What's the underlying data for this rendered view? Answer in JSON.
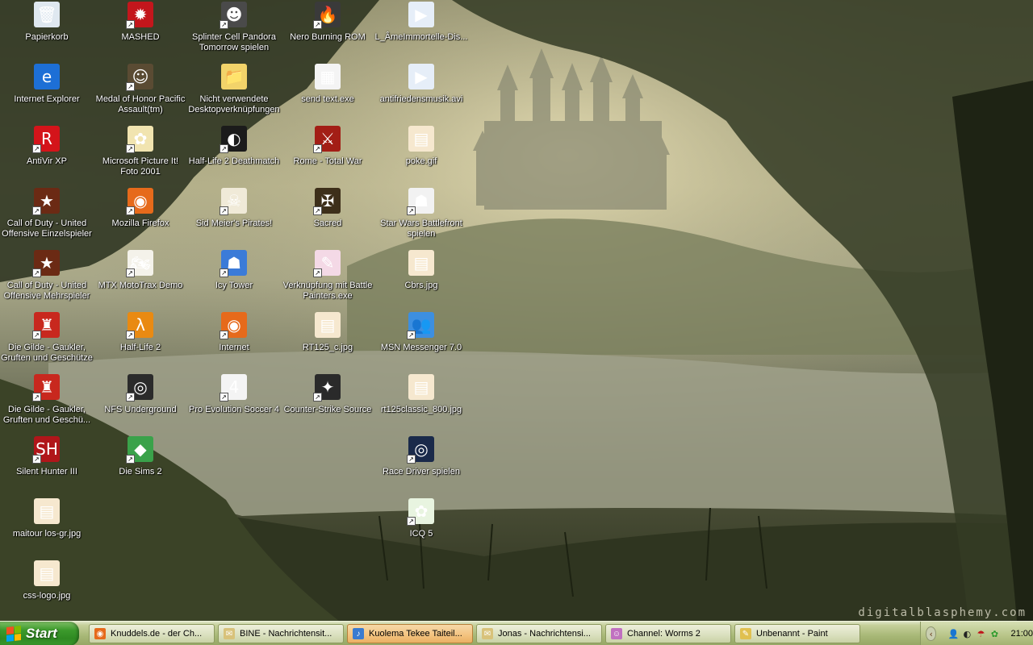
{
  "wallpaper": {
    "watermark": "digitalblasphemy.com"
  },
  "desktop_icons": [
    {
      "label": "Papierkorb",
      "icon": "recycle-bin-icon",
      "glyph": "🗑",
      "bg": "#dfe8f0",
      "shortcut": false
    },
    {
      "label": "Internet Explorer",
      "icon": "internet-explorer-icon",
      "glyph": "e",
      "bg": "#1d6fd6",
      "shortcut": false
    },
    {
      "label": "AntiVir XP",
      "icon": "antivir-icon",
      "glyph": "R",
      "bg": "#d4141a",
      "shortcut": true
    },
    {
      "label": "Call of Duty - United Offensive Einzelspieler",
      "icon": "call-of-duty-icon",
      "glyph": "★",
      "bg": "#6b2a14",
      "shortcut": true
    },
    {
      "label": "Call of Duty - United Offensive Mehrspieler",
      "icon": "call-of-duty-icon",
      "glyph": "★",
      "bg": "#6b2a14",
      "shortcut": true
    },
    {
      "label": "Die Gilde - Gaukler, Gruften und Geschütze",
      "icon": "die-gilde-icon",
      "glyph": "♜",
      "bg": "#c8281e",
      "shortcut": true
    },
    {
      "label": "Die Gilde - Gaukler, Gruften und Geschü...",
      "icon": "die-gilde-icon",
      "glyph": "♜",
      "bg": "#c8281e",
      "shortcut": true
    },
    {
      "label": "Silent Hunter III",
      "icon": "silent-hunter-icon",
      "glyph": "SH",
      "bg": "#b0161a",
      "shortcut": true
    },
    {
      "label": "maitour los-gr.jpg",
      "icon": "image-file-icon",
      "glyph": "▤",
      "bg": "#f6e8cf",
      "shortcut": false
    },
    {
      "label": "css-logo.jpg",
      "icon": "image-file-icon",
      "glyph": "▤",
      "bg": "#f6e8cf",
      "shortcut": false
    },
    {
      "label": "MASHED",
      "icon": "mashed-icon",
      "glyph": "✹",
      "bg": "#c3161c",
      "shortcut": true
    },
    {
      "label": "Medal of Honor Pacific Assault(tm)",
      "icon": "medal-of-honor-icon",
      "glyph": "☺",
      "bg": "#5a4b33",
      "shortcut": true
    },
    {
      "label": "Microsoft Picture It! Foto 2001",
      "icon": "picture-it-icon",
      "glyph": "✿",
      "bg": "#f1e4b0",
      "shortcut": true
    },
    {
      "label": "Mozilla Firefox",
      "icon": "firefox-icon",
      "glyph": "◉",
      "bg": "#e66a1b",
      "shortcut": true
    },
    {
      "label": "MTX MotoTrax Demo",
      "icon": "mototrax-icon",
      "glyph": "🏍",
      "bg": "#f4f2ea",
      "shortcut": true
    },
    {
      "label": "Half-Life 2",
      "icon": "half-life-icon",
      "glyph": "λ",
      "bg": "#e98a12",
      "shortcut": true
    },
    {
      "label": "NFS Underground",
      "icon": "nfs-underground-icon",
      "glyph": "◎",
      "bg": "#2b2b2b",
      "shortcut": true
    },
    {
      "label": "Die Sims 2",
      "icon": "sims-icon",
      "glyph": "◆",
      "bg": "#3aa24a",
      "shortcut": true
    },
    {
      "label": "Splinter Cell Pandora Tomorrow spielen",
      "icon": "splinter-cell-icon",
      "glyph": "☻",
      "bg": "#4a4a4a",
      "shortcut": true
    },
    {
      "label": "Nicht verwendete Desktopverknüpfungen",
      "icon": "folder-icon",
      "glyph": "📁",
      "bg": "#f2d36a",
      "shortcut": false
    },
    {
      "label": "Half-Life 2 Deathmatch",
      "icon": "steam-icon",
      "glyph": "◐",
      "bg": "#1b1b1b",
      "shortcut": true
    },
    {
      "label": "Sid Meier's Pirates!",
      "icon": "pirates-icon",
      "glyph": "☠",
      "bg": "#f0ead8",
      "shortcut": true
    },
    {
      "label": "Icy Tower",
      "icon": "icy-tower-icon",
      "glyph": "☗",
      "bg": "#3b7bd8",
      "shortcut": true
    },
    {
      "label": "Internet",
      "icon": "firefox-icon",
      "glyph": "◉",
      "bg": "#e66a1b",
      "shortcut": true
    },
    {
      "label": "Pro Evolution Soccer 4",
      "icon": "pes4-icon",
      "glyph": "4",
      "bg": "#f4f4f4",
      "shortcut": true
    },
    {
      "label": "Nero Burning ROM",
      "icon": "nero-icon",
      "glyph": "🔥",
      "bg": "#3a3a3a",
      "shortcut": true
    },
    {
      "label": "send text.exe",
      "icon": "exe-icon",
      "glyph": "▦",
      "bg": "#f4f4f4",
      "shortcut": false
    },
    {
      "label": "Rome - Total War",
      "icon": "rome-total-war-icon",
      "glyph": "⚔",
      "bg": "#a31e16",
      "shortcut": true
    },
    {
      "label": "Sacred",
      "icon": "sacred-icon",
      "glyph": "✠",
      "bg": "#3d2f1a",
      "shortcut": true
    },
    {
      "label": "Verknüpfung mit Battle Painters.exe",
      "icon": "battle-painters-icon",
      "glyph": "✎",
      "bg": "#f4d9e6",
      "shortcut": true
    },
    {
      "label": "RT125_c.jpg",
      "icon": "image-file-icon",
      "glyph": "▤",
      "bg": "#f6e8cf",
      "shortcut": false
    },
    {
      "label": "Counter-Strike Source",
      "icon": "counter-strike-icon",
      "glyph": "✦",
      "bg": "#2a2a2a",
      "shortcut": true
    },
    {
      "label": "L_ÂmeImmortelle-Dis...",
      "icon": "media-file-icon",
      "glyph": "▶",
      "bg": "#e6eef8",
      "shortcut": false
    },
    {
      "label": "antifriedensmusik.avi",
      "icon": "media-file-icon",
      "glyph": "▶",
      "bg": "#e6eef8",
      "shortcut": false
    },
    {
      "label": "poke.gif",
      "icon": "gif-file-icon",
      "glyph": "▤",
      "bg": "#f6e8cf",
      "shortcut": false
    },
    {
      "label": "Star Wars Battlefront spielen",
      "icon": "star-wars-icon",
      "glyph": "☗",
      "bg": "#f2f2f2",
      "shortcut": true
    },
    {
      "label": "Cbrs.jpg",
      "icon": "image-file-icon",
      "glyph": "▤",
      "bg": "#f6e8cf",
      "shortcut": false
    },
    {
      "label": "MSN Messenger 7.0",
      "icon": "msn-messenger-icon",
      "glyph": "👥",
      "bg": "#3d8fe0",
      "shortcut": true
    },
    {
      "label": "rt125classic_800.jpg",
      "icon": "image-file-icon",
      "glyph": "▤",
      "bg": "#f6e8cf",
      "shortcut": false
    },
    {
      "label": "Race Driver spielen",
      "icon": "race-driver-icon",
      "glyph": "◎",
      "bg": "#1a2a4a",
      "shortcut": true
    },
    {
      "label": "ICQ 5",
      "icon": "icq-icon",
      "glyph": "✿",
      "bg": "#e8f4e0",
      "shortcut": true
    }
  ],
  "taskbar": {
    "start_label": "Start",
    "tasks": [
      {
        "label": "Knuddels.de - der Ch...",
        "icon": "firefox-icon",
        "glyph": "◉",
        "bg": "#e66a1b",
        "active": false
      },
      {
        "label": "BINE - Nachrichtensit...",
        "icon": "message-window-icon",
        "glyph": "✉",
        "bg": "#d8c27a",
        "active": false
      },
      {
        "label": "Kuolema Tekee Taiteil...",
        "icon": "media-player-icon",
        "glyph": "♪",
        "bg": "#3a7bd0",
        "active": true
      },
      {
        "label": "Jonas - Nachrichtensi...",
        "icon": "message-window-icon",
        "glyph": "✉",
        "bg": "#d8c27a",
        "active": false
      },
      {
        "label": "Channel: Worms 2",
        "icon": "chat-channel-icon",
        "glyph": "☺",
        "bg": "#c070c0",
        "active": false
      },
      {
        "label": "Unbenannt - Paint",
        "icon": "paint-icon",
        "glyph": "✎",
        "bg": "#e0c050",
        "active": false
      }
    ],
    "tray": {
      "clock": "21:00",
      "icons": [
        {
          "icon": "msn-tray-icon",
          "glyph": "👤",
          "color": "#2a6acb"
        },
        {
          "icon": "steam-tray-icon",
          "glyph": "◐",
          "color": "#222"
        },
        {
          "icon": "antivir-tray-icon",
          "glyph": "☂",
          "color": "#c0141a"
        },
        {
          "icon": "icq-tray-icon",
          "glyph": "✿",
          "color": "#2b9a2b"
        }
      ]
    }
  }
}
